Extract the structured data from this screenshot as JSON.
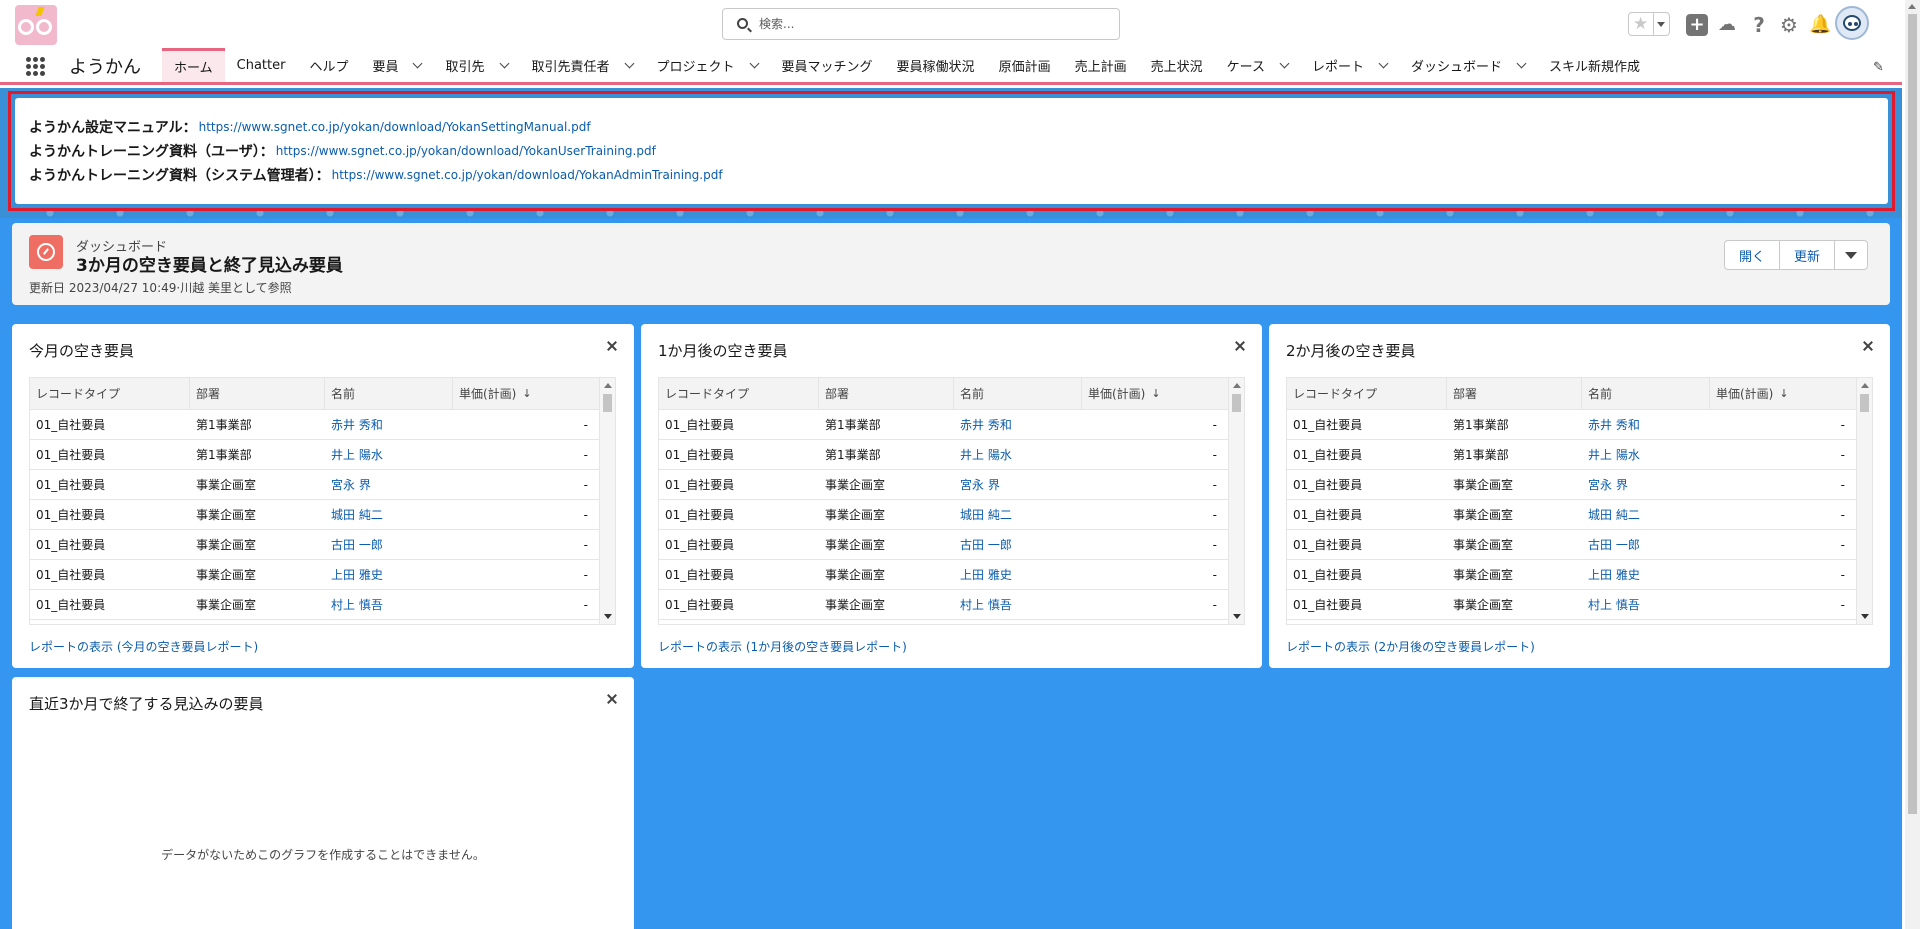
{
  "header": {
    "search_placeholder": "検索...",
    "icons": [
      "star-icon",
      "plus-icon",
      "cloud-icon",
      "help-icon",
      "gear-icon",
      "bell-icon",
      "avatar"
    ]
  },
  "nav": {
    "app_name": "ようかん",
    "tabs": [
      {
        "label": "ホーム",
        "active": true,
        "dropdown": false
      },
      {
        "label": "Chatter",
        "active": false,
        "dropdown": false
      },
      {
        "label": "ヘルプ",
        "active": false,
        "dropdown": false
      },
      {
        "label": "要員",
        "active": false,
        "dropdown": true
      },
      {
        "label": "取引先",
        "active": false,
        "dropdown": true
      },
      {
        "label": "取引先責任者",
        "active": false,
        "dropdown": true
      },
      {
        "label": "プロジェクト",
        "active": false,
        "dropdown": true
      },
      {
        "label": "要員マッチング",
        "active": false,
        "dropdown": false
      },
      {
        "label": "要員稼働状況",
        "active": false,
        "dropdown": false
      },
      {
        "label": "原価計画",
        "active": false,
        "dropdown": false
      },
      {
        "label": "売上計画",
        "active": false,
        "dropdown": false
      },
      {
        "label": "売上状況",
        "active": false,
        "dropdown": false
      },
      {
        "label": "ケース",
        "active": false,
        "dropdown": true
      },
      {
        "label": "レポート",
        "active": false,
        "dropdown": true
      },
      {
        "label": "ダッシュボード",
        "active": false,
        "dropdown": true
      },
      {
        "label": "スキル新規作成",
        "active": false,
        "dropdown": false
      }
    ]
  },
  "announcement": {
    "lines": [
      {
        "label": "ようかん設定マニュアル：",
        "url": "https://www.sgnet.co.jp/yokan/download/YokanSettingManual.pdf"
      },
      {
        "label": "ようかんトレーニング資料（ユーザ）：",
        "url": "https://www.sgnet.co.jp/yokan/download/YokanUserTraining.pdf"
      },
      {
        "label": "ようかんトレーニング資料（システム管理者）：",
        "url": "https://www.sgnet.co.jp/yokan/download/YokanAdminTraining.pdf"
      }
    ]
  },
  "dashboard": {
    "kind": "ダッシュボード",
    "title": "3か月の空き要員と終了見込み要員",
    "meta": "更新日 2023/04/27 10:49·川越 美里として参照",
    "buttons": {
      "open": "開く",
      "refresh": "更新"
    }
  },
  "table_columns": [
    "レコードタイプ",
    "部署",
    "名前",
    "単価(計画)"
  ],
  "sort_arrow": "↓",
  "cards": [
    {
      "title": "今月の空き要員",
      "report_link": "レポートの表示 (今月の空き要員レポート)"
    },
    {
      "title": "1か月後の空き要員",
      "report_link": "レポートの表示 (1か月後の空き要員レポート)"
    },
    {
      "title": "2か月後の空き要員",
      "report_link": "レポートの表示 (2か月後の空き要員レポート)"
    }
  ],
  "rows": [
    [
      "01_自社要員",
      "第1事業部",
      "赤井 秀和",
      "-"
    ],
    [
      "01_自社要員",
      "第1事業部",
      "井上 陽水",
      "-"
    ],
    [
      "01_自社要員",
      "事業企画室",
      "宮永 界",
      "-"
    ],
    [
      "01_自社要員",
      "事業企画室",
      "城田 純二",
      "-"
    ],
    [
      "01_自社要員",
      "事業企画室",
      "古田 一郎",
      "-"
    ],
    [
      "01_自社要員",
      "事業企画室",
      "上田 雅史",
      "-"
    ],
    [
      "01_自社要員",
      "事業企画室",
      "村上 慎吾",
      "-"
    ]
  ],
  "ending_card": {
    "title": "直近3か月で終了する見込みの要員",
    "empty_message": "データがないためこのグラフを作成することはできません。"
  },
  "colors": {
    "accent": "#e8657f",
    "background": "#3596ef",
    "link": "#0b5cab",
    "highlight_border": "#e0192d"
  }
}
